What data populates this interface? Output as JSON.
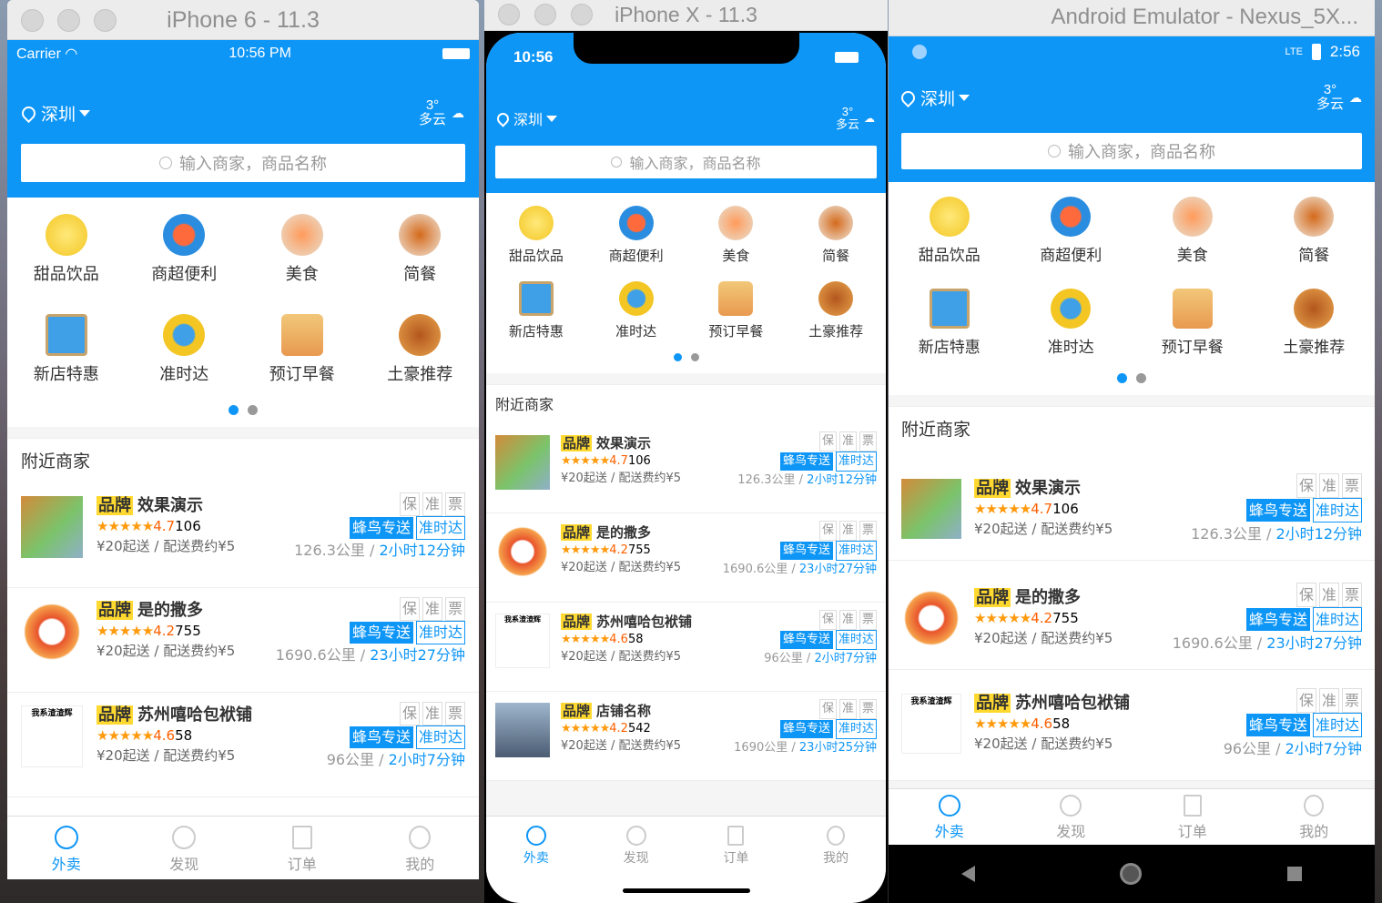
{
  "windows": [
    {
      "title": "iPhone 6 - 11.3",
      "carrier": "Carrier",
      "time": "10:56 PM"
    },
    {
      "title": "iPhone X - 11.3",
      "time": "10:56"
    },
    {
      "title": "Android Emulator - Nexus_5X...",
      "time": "2:56",
      "network": "LTE"
    }
  ],
  "header": {
    "city": "深圳",
    "temp": "3°",
    "weather": "多云",
    "search_placeholder": "输入商家，商品名称"
  },
  "categories": [
    "甜品饮品",
    "商超便利",
    "美食",
    "简餐",
    "新店特惠",
    "准时达",
    "预订早餐",
    "土豪推荐"
  ],
  "category_icons": [
    "dessert-icon",
    "supermarket-icon",
    "food-icon",
    "meal-icon",
    "new-shop-icon",
    "on-time-icon",
    "breakfast-icon",
    "premium-icon"
  ],
  "pager": {
    "pages": 2,
    "active": 1
  },
  "nearby_title": "附近商家",
  "shop_labels": {
    "brand": "品牌",
    "guarantee": "保",
    "ontime": "准",
    "invoice": "票",
    "fengniao": "蜂鸟专送",
    "zhunshida": "准时达",
    "min_order": "¥20起送 / 配送费约¥5"
  },
  "shops": [
    {
      "name": "效果演示",
      "stars": "★★★★★",
      "rating": "4.7",
      "sales": "106",
      "distance": "126.3公里",
      "eta": "2小时12分钟"
    },
    {
      "name": "是的撒多",
      "stars": "★★★★★",
      "rating": "4.2",
      "sales": "755",
      "distance": "1690.6公里",
      "eta": "23小时27分钟"
    },
    {
      "name": "苏州嘻哈包袱铺",
      "stars": "★★★★★",
      "rating": "4.6",
      "sales": "58",
      "distance": "96公里",
      "eta": "2小时7分钟"
    },
    {
      "name": "店铺名称",
      "stars": "★★★★★",
      "rating": "4.2",
      "sales": "542",
      "distance": "1690公里",
      "eta": "23小时25分钟"
    }
  ],
  "thumb_caption": "我系渣渣辉",
  "tabs": [
    {
      "label": "外卖",
      "icon": "takeout-icon"
    },
    {
      "label": "发现",
      "icon": "compass-icon"
    },
    {
      "label": "订单",
      "icon": "order-icon"
    },
    {
      "label": "我的",
      "icon": "user-icon"
    }
  ],
  "colors": {
    "brand_blue": "#0e96f7",
    "rating_orange": "#ff6000",
    "star": "#ff9a0d",
    "brand_yellow": "#ffd930"
  }
}
